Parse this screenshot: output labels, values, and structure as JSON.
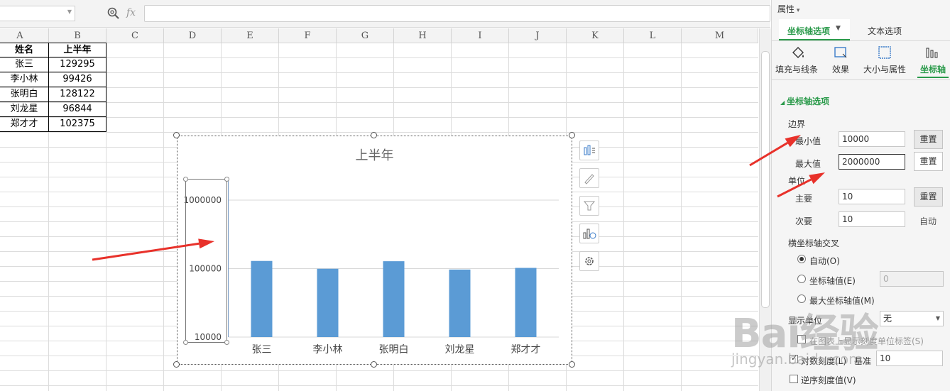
{
  "formula_bar": {
    "fx_label": "fx",
    "namebox_value": ""
  },
  "columns": [
    "A",
    "B",
    "C",
    "D",
    "E",
    "F",
    "G",
    "H",
    "I",
    "J",
    "K",
    "L",
    "M"
  ],
  "table": {
    "headers": [
      "姓名",
      "上半年"
    ],
    "rows": [
      {
        "name": "张三",
        "value": "129295"
      },
      {
        "name": "李小林",
        "value": "99426"
      },
      {
        "name": "张明白",
        "value": "128122"
      },
      {
        "name": "刘龙星",
        "value": "96844"
      },
      {
        "name": "郑才才",
        "value": "102375"
      }
    ]
  },
  "chart_data": {
    "type": "bar",
    "title": "上半年",
    "categories": [
      "张三",
      "李小林",
      "张明白",
      "刘龙星",
      "郑才才"
    ],
    "values": [
      129295,
      99426,
      128122,
      96844,
      102375
    ],
    "y_scale": "log10",
    "ylim": [
      10000,
      1000000
    ],
    "y_ticks": [
      "10000",
      "100000",
      "1000000"
    ],
    "bar_color": "#5b9bd5",
    "grid": true,
    "legend": "none"
  },
  "panel": {
    "title": "属性",
    "tabs": [
      "坐标轴选项",
      "文本选项"
    ],
    "subtabs": [
      "填充与线条",
      "效果",
      "大小与属性",
      "坐标轴"
    ],
    "section_title": "坐标轴选项",
    "bounds_label": "边界",
    "min_label": "最小值",
    "min_value": "10000",
    "max_label": "最大值",
    "max_value": "2000000",
    "reset_label": "重置",
    "units_label": "单位",
    "major_label": "主要",
    "major_value": "10",
    "minor_label": "次要",
    "minor_value": "10",
    "auto_label": "自动",
    "cross_label": "横坐标轴交叉",
    "cross_auto": "自动(O)",
    "cross_value": "坐标轴值(E)",
    "cross_value_input": "0",
    "cross_max": "最大坐标轴值(M)",
    "display_units_label": "显示单位",
    "display_units_value": "无",
    "show_units_label": "在图表上显示刻度单位标签(S)",
    "log_scale_label": "对数刻度(L)",
    "base_label": "基准",
    "base_value": "10",
    "reverse_label": "逆序刻度值(V)",
    "accent_color": "#2a9a4a"
  },
  "watermark": {
    "brand": "Bai经验",
    "url": "jingyan.baidu.com"
  },
  "annotation_color": "#e8312a"
}
